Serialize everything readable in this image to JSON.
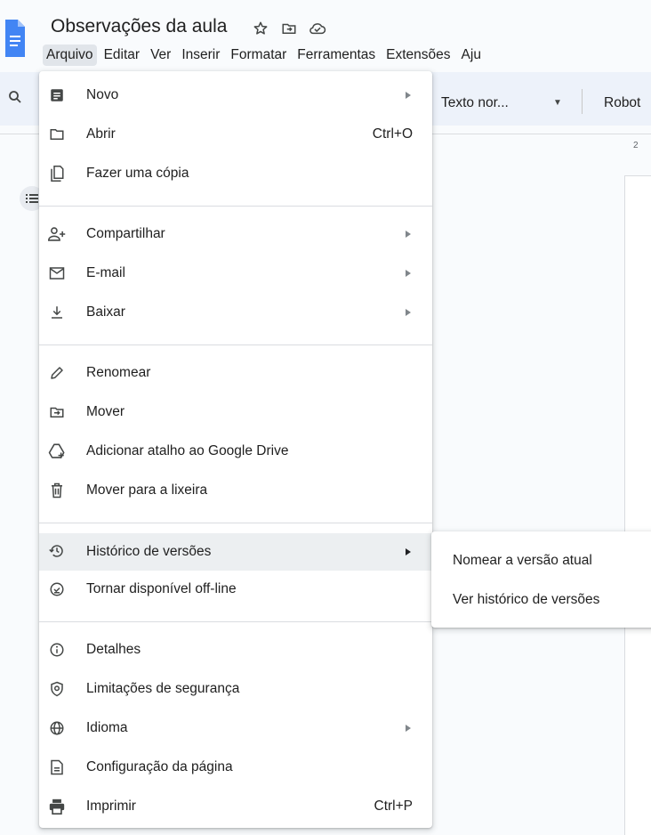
{
  "doc": {
    "title": "Observações da aula",
    "icons": [
      "star-icon",
      "move-to-folder-icon",
      "cloud-saved-icon"
    ]
  },
  "menubar": [
    "Arquivo",
    "Editar",
    "Ver",
    "Inserir",
    "Formatar",
    "Ferramentas",
    "Extensões",
    "Aju"
  ],
  "toolbar": {
    "style_label": "Texto nor...",
    "font_label": "Robot",
    "ruler_mark": "2"
  },
  "file_menu": {
    "items": [
      {
        "label": "Novo",
        "icon": "document-icon",
        "submenu": true
      },
      {
        "label": "Abrir",
        "icon": "folder-icon",
        "shortcut": "Ctrl+O"
      },
      {
        "label": "Fazer uma cópia",
        "icon": "copy-icon"
      },
      {
        "label": "Compartilhar",
        "icon": "share-person-icon",
        "submenu": true
      },
      {
        "label": "E-mail",
        "icon": "mail-icon",
        "submenu": true
      },
      {
        "label": "Baixar",
        "icon": "download-icon",
        "submenu": true
      },
      {
        "label": "Renomear",
        "icon": "pencil-icon"
      },
      {
        "label": "Mover",
        "icon": "move-to-folder-icon"
      },
      {
        "label": "Adicionar atalho ao Google Drive",
        "icon": "drive-shortcut-icon"
      },
      {
        "label": "Mover para a lixeira",
        "icon": "trash-icon"
      },
      {
        "label": "Histórico de versões",
        "icon": "history-icon",
        "submenu": true,
        "highlighted": true
      },
      {
        "label": "Tornar disponível off-line",
        "icon": "offline-icon"
      },
      {
        "label": "Detalhes",
        "icon": "info-icon"
      },
      {
        "label": "Limitações de segurança",
        "icon": "security-icon"
      },
      {
        "label": "Idioma",
        "icon": "globe-icon",
        "submenu": true
      },
      {
        "label": "Configuração da página",
        "icon": "page-setup-icon"
      },
      {
        "label": "Imprimir",
        "icon": "print-icon",
        "shortcut": "Ctrl+P"
      }
    ]
  },
  "version_submenu": {
    "items": [
      "Nomear a versão atual",
      "Ver histórico de versões"
    ]
  },
  "colors": {
    "background": "#f9fbfd",
    "toolbar": "#edf2fa",
    "hover": "#eceff1",
    "docs_blue": "#4285f4",
    "text": "#1f1f1f"
  }
}
